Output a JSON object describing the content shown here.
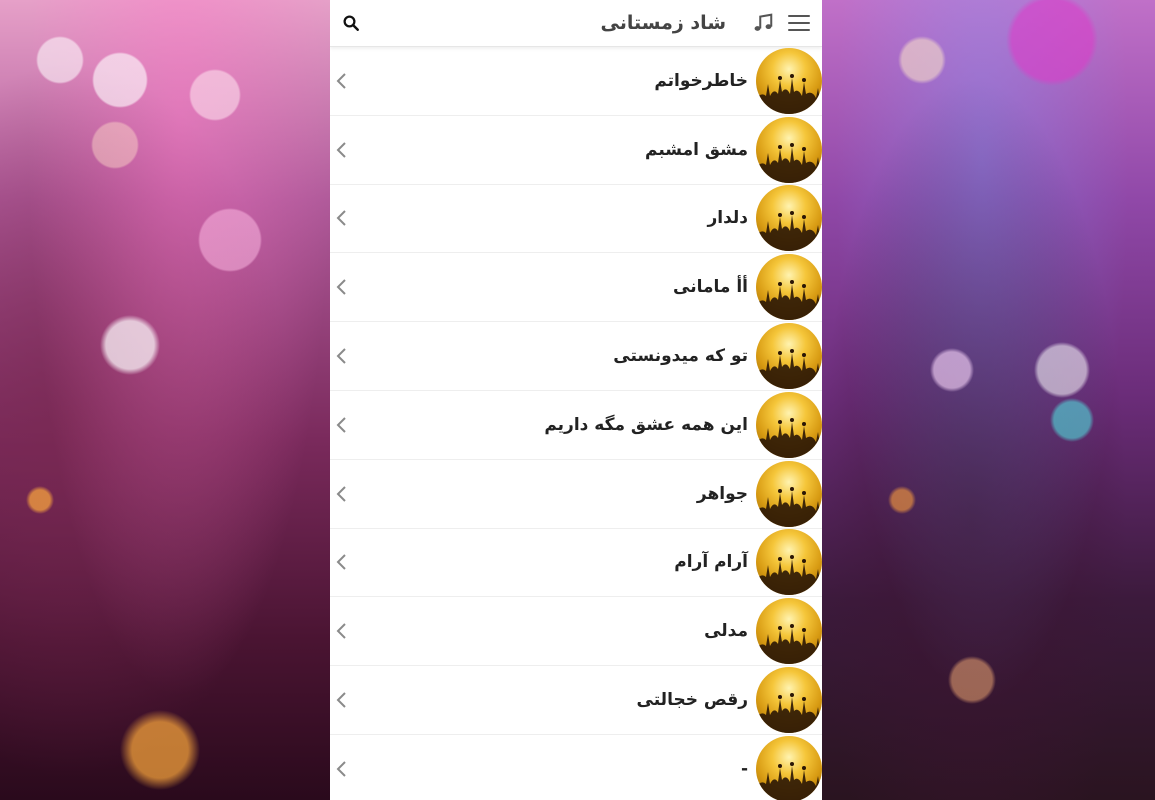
{
  "app": {
    "title": "شاد زمستانی"
  },
  "icons": {
    "menu": "hamburger-menu-icon",
    "music": "music-note-icon",
    "search": "search-icon",
    "chevron": "chevron-left-icon"
  },
  "colors": {
    "avatar_gold": "#e0a61c",
    "text": "#222222",
    "header_text": "#444444"
  },
  "songs": [
    {
      "label": "خاطرخواتم"
    },
    {
      "label": "مشق امشبم"
    },
    {
      "label": "دلدار"
    },
    {
      "label": "أأ مامانی"
    },
    {
      "label": "تو که میدونستی"
    },
    {
      "label": "این همه عشق مگه داریم"
    },
    {
      "label": "جواهر"
    },
    {
      "label": "آرام آرام"
    },
    {
      "label": "مدلی"
    },
    {
      "label": "رقص خجالتی"
    },
    {
      "label": "-"
    }
  ]
}
